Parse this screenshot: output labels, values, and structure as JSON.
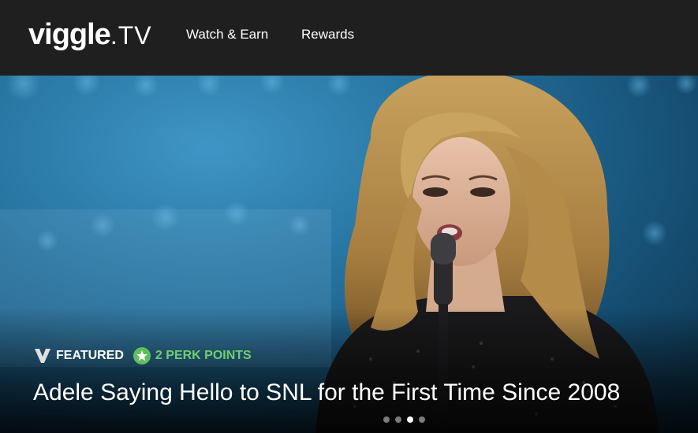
{
  "header": {
    "logo_brand": "viggle",
    "logo_suffix": ".TV",
    "nav": [
      {
        "label": "Watch & Earn"
      },
      {
        "label": "Rewards"
      }
    ]
  },
  "hero": {
    "featured_label": "FEATURED",
    "perk_points_label": "2 PERK POINTS",
    "headline": "Adele Saying Hello to SNL for the First Time Since 2008",
    "carousel": {
      "slide_count": 4,
      "active_index": 2
    }
  },
  "colors": {
    "header_bg": "#1f1f1f",
    "perk_green": "#6fcf6f",
    "text": "#ffffff",
    "hero_blue": "#26739f"
  },
  "icons": {
    "featured": "viggle-v-icon",
    "perk": "star-badge-icon"
  }
}
